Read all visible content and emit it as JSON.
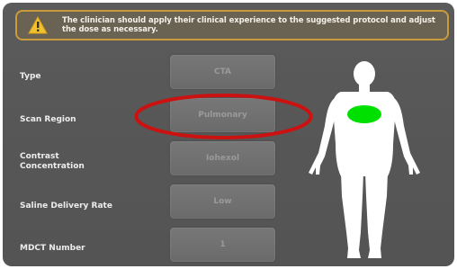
{
  "warning": {
    "message": "The clinician should apply their clinical experience to the suggested protocol and adjust the dose as necessary.",
    "icon": "warning-triangle-icon",
    "border_color": "#c99c3a"
  },
  "fields": [
    {
      "label": "Type",
      "value": "CTA"
    },
    {
      "label": "Scan Region",
      "value": "Pulmonary"
    },
    {
      "label": "Contrast Concentration",
      "value": "Iohexol"
    },
    {
      "label": "Saline Delivery Rate",
      "value": "Low"
    },
    {
      "label": "MDCT Number",
      "value": "1"
    }
  ],
  "body_map": {
    "icon": "human-body-icon",
    "highlight_region": "chest",
    "highlight_color": "#00e000"
  },
  "annotation": {
    "color": "#cc1111"
  }
}
